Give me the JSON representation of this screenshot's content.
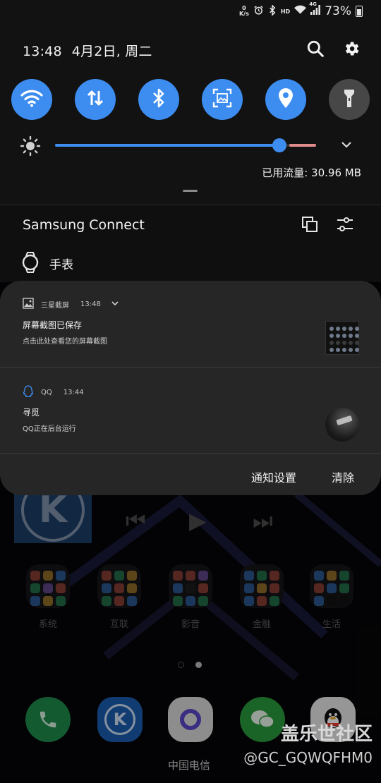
{
  "status_bar": {
    "net_speed_value": "0",
    "net_speed_unit": "K/s",
    "hd_label": "HD",
    "network_label": "4G",
    "battery_percent": "73%",
    "battery_level": 0.73
  },
  "header": {
    "time": "13:48",
    "date": "4月2日, 周二",
    "search_icon": "search-icon",
    "settings_icon": "gear-icon"
  },
  "quick_settings": {
    "tiles": [
      {
        "icon": "wifi-icon",
        "active": true
      },
      {
        "icon": "mobile-data-icon",
        "active": true
      },
      {
        "icon": "bluetooth-icon",
        "active": true
      },
      {
        "icon": "screenshot-icon",
        "active": true
      },
      {
        "icon": "location-icon",
        "active": true
      },
      {
        "icon": "flashlight-icon",
        "active": false
      }
    ],
    "brightness_level": 0.86,
    "data_usage": "已用流量: 30.96 MB"
  },
  "samsung_connect": {
    "title": "Samsung Connect",
    "device_label": "手表"
  },
  "notifications": [
    {
      "app": "三星截屏",
      "time": "13:48",
      "title": "屏幕截图已保存",
      "text": "点击此处查看您的屏幕截图"
    },
    {
      "app": "QQ",
      "time": "13:44",
      "title": "寻觅",
      "text": "QQ正在后台运行"
    }
  ],
  "notification_actions": {
    "settings_label": "通知设置",
    "clear_label": "清除"
  },
  "home_screen": {
    "folders": [
      "系统",
      "互联",
      "影音",
      "金融",
      "生活"
    ],
    "carrier": "中国电信",
    "watermark": "盖乐世社区",
    "watermark_user": "@GC_GQWQFHM0",
    "page_index": 1,
    "page_count": 2
  },
  "colors": {
    "accent": "#3d8df1",
    "panel": "#121212",
    "card": "#262626"
  }
}
